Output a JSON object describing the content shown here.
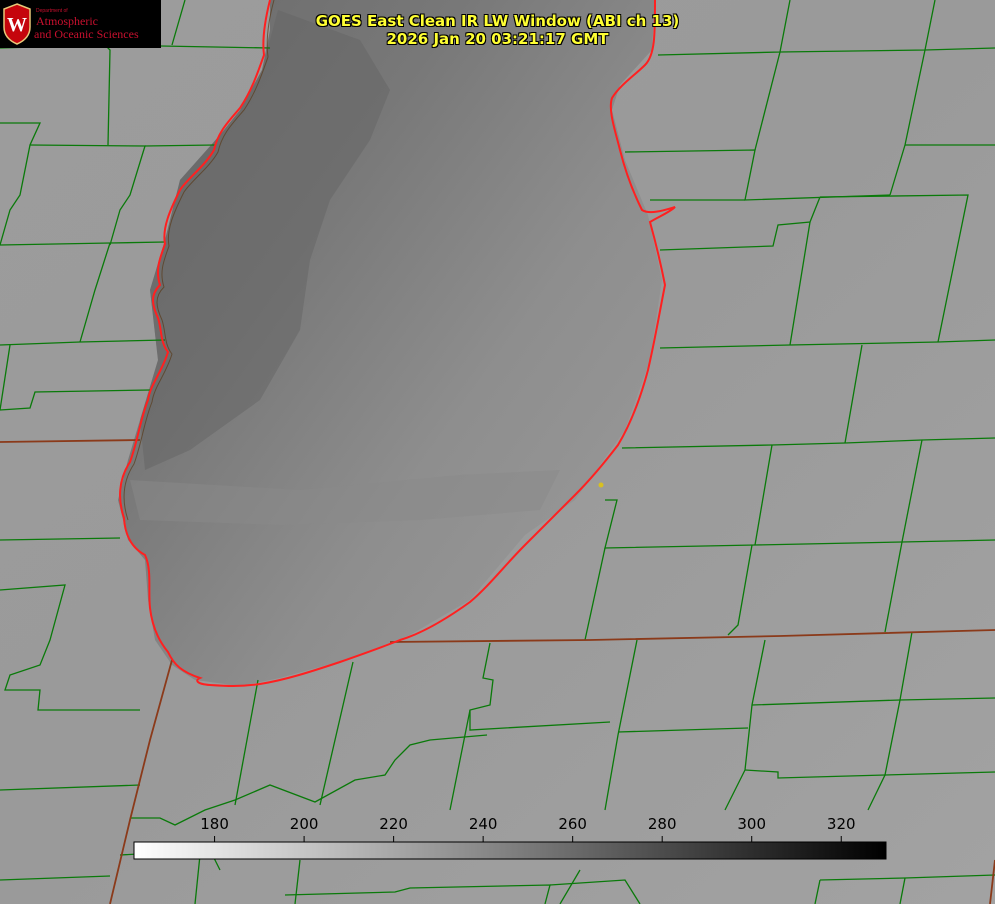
{
  "logo": {
    "department": "Department of",
    "line1": "Atmospheric",
    "line2": "and Oceanic Sciences",
    "crest_letter": "W",
    "crest_color": "#c5050c"
  },
  "title": {
    "line1": "GOES East Clean IR LW Window (ABI ch 13)",
    "line2": "2026 Jan 20 03:21:17 GMT"
  },
  "colorbar": {
    "ticks": [
      "180",
      "200",
      "220",
      "240",
      "260",
      "280",
      "300",
      "320"
    ],
    "tick_values": [
      180,
      200,
      220,
      240,
      260,
      280,
      300,
      320
    ],
    "range": [
      162,
      330
    ],
    "low_color": "#ffffff",
    "high_color": "#000000"
  },
  "colors": {
    "county_lines": "#0a7a0a",
    "lake_outline": "#ff2020",
    "state_lines": "#8b3a1a",
    "marker": "#d8c020",
    "title": "#ffff33"
  }
}
